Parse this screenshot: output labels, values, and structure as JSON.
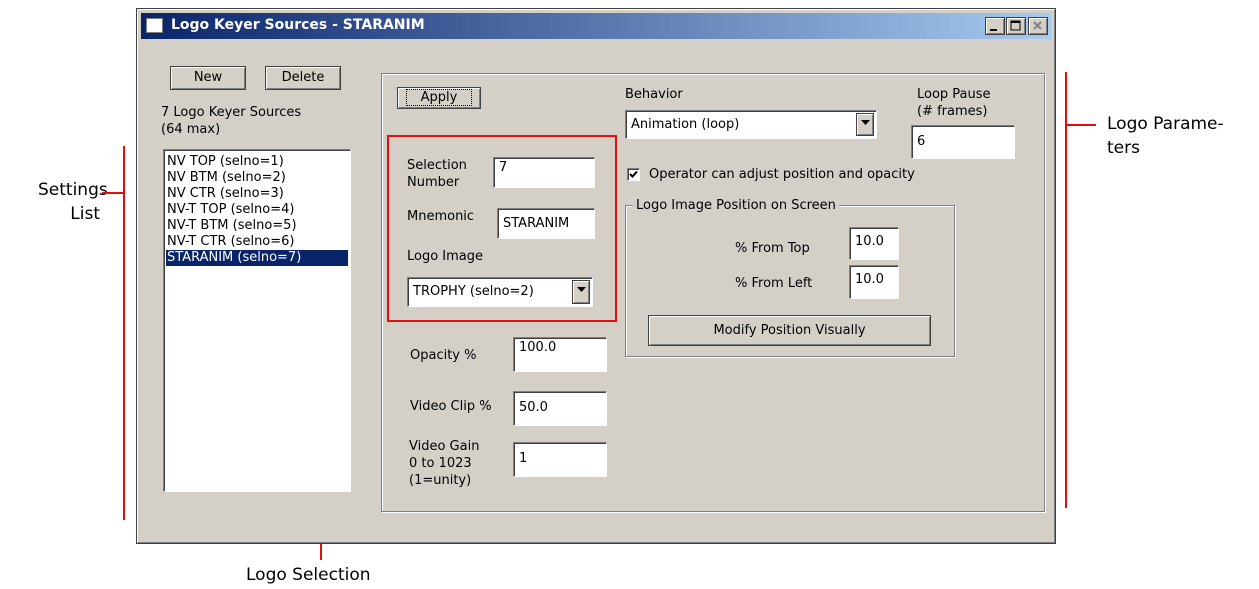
{
  "window": {
    "title": "Logo Keyer Sources - STARANIM",
    "controls": {
      "minimize": "_",
      "maximize": "□",
      "close": "✕"
    }
  },
  "sources": {
    "new_label": "New",
    "delete_label": "Delete",
    "count_line1": "7 Logo Keyer Sources",
    "count_line2": "(64 max)",
    "items": [
      {
        "label": "NV TOP (selno=1)",
        "selected": false
      },
      {
        "label": "NV BTM (selno=2)",
        "selected": false
      },
      {
        "label": "NV CTR (selno=3)",
        "selected": false
      },
      {
        "label": "NV-T TOP (selno=4)",
        "selected": false
      },
      {
        "label": "NV-T BTM (selno=5)",
        "selected": false
      },
      {
        "label": "NV-T CTR (selno=6)",
        "selected": false
      },
      {
        "label": "STARANIM (selno=7)",
        "selected": true
      }
    ]
  },
  "params": {
    "apply_label": "Apply",
    "selection_number_label_1": "Selection",
    "selection_number_label_2": "Number",
    "selection_number_value": "7",
    "mnemonic_label": "Mnemonic",
    "mnemonic_value": "STARANIM",
    "logo_image_label": "Logo Image",
    "logo_image_value": "TROPHY (selno=2)",
    "opacity_label": "Opacity %",
    "opacity_value": "100.0",
    "video_clip_label": "Video Clip %",
    "video_clip_value": "50.0",
    "video_gain_label_1": "Video Gain",
    "video_gain_label_2": "0 to 1023",
    "video_gain_label_3": "(1=unity)",
    "video_gain_value": "1",
    "behavior_label": "Behavior",
    "behavior_value": "Animation (loop)",
    "loop_pause_label_1": "Loop Pause",
    "loop_pause_label_2": "(# frames)",
    "loop_pause_value": "6",
    "operator_adjust_label": "Operator can adjust position and opacity",
    "operator_adjust_checked": true,
    "position_group_label": "Logo Image Position on Screen",
    "from_top_label": "% From Top",
    "from_top_value": "10.0",
    "from_left_label": "% From Left",
    "from_left_value": "10.0",
    "modify_position_label": "Modify Position Visually"
  },
  "annotations": {
    "settings_list_1": "Settings",
    "settings_list_2": "List",
    "logo_selection": "Logo Selection",
    "logo_parameters_1": "Logo Parame-",
    "logo_parameters_2": "ters"
  },
  "colors": {
    "accent_red": "#e01010",
    "title_blue": "#0a246a",
    "window_gray": "#d4d0c8"
  }
}
